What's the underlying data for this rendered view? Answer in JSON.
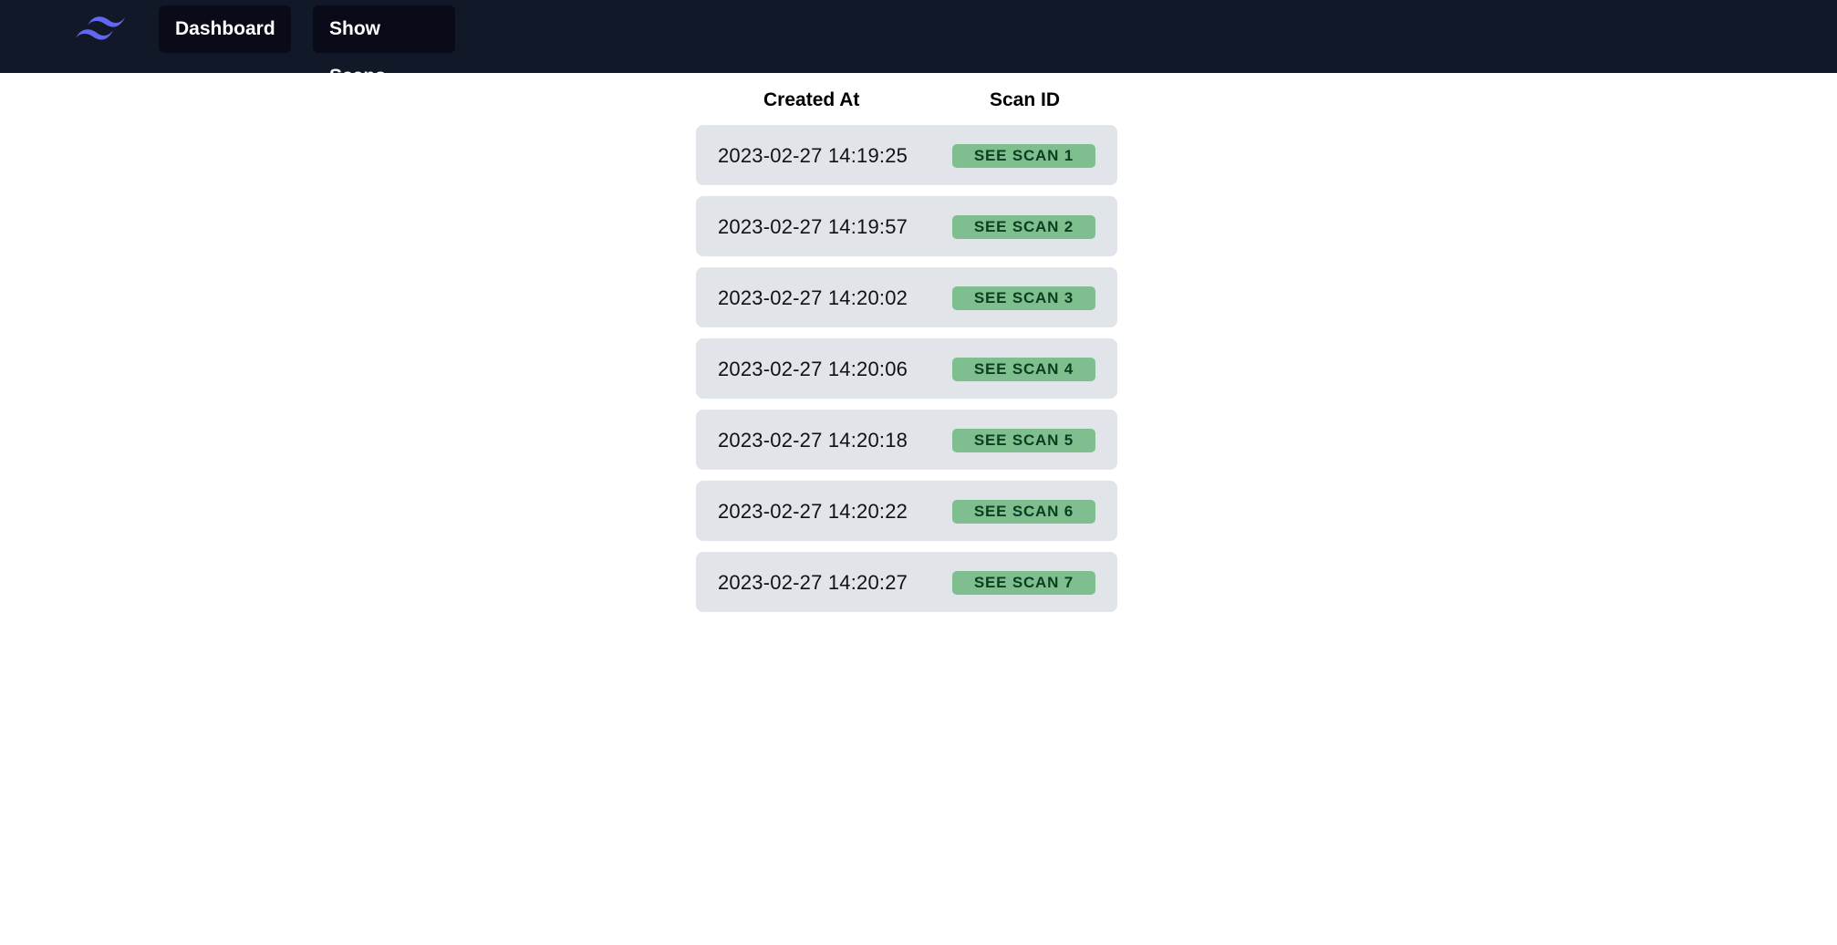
{
  "header": {
    "logo_icon": "tailwind-wave-logo-icon",
    "logo_color": "#6366f1",
    "nav": [
      {
        "label": "Dashboard"
      },
      {
        "label": "Show Scans"
      }
    ]
  },
  "table": {
    "columns": [
      "Created At",
      "Scan ID"
    ],
    "rows": [
      {
        "created_at": "2023-02-27 14:19:25",
        "link": "SEE SCAN 1"
      },
      {
        "created_at": "2023-02-27 14:19:57",
        "link": "SEE SCAN 2"
      },
      {
        "created_at": "2023-02-27 14:20:02",
        "link": "SEE SCAN 3"
      },
      {
        "created_at": "2023-02-27 14:20:06",
        "link": "SEE SCAN 4"
      },
      {
        "created_at": "2023-02-27 14:20:18",
        "link": "SEE SCAN 5"
      },
      {
        "created_at": "2023-02-27 14:20:22",
        "link": "SEE SCAN 6"
      },
      {
        "created_at": "2023-02-27 14:20:27",
        "link": "SEE SCAN 7"
      }
    ]
  },
  "colors": {
    "topbar": "#111827",
    "row_bg": "#e1e4e9",
    "link_bg": "#7fbf8f",
    "link_text": "#0b3d1f"
  }
}
